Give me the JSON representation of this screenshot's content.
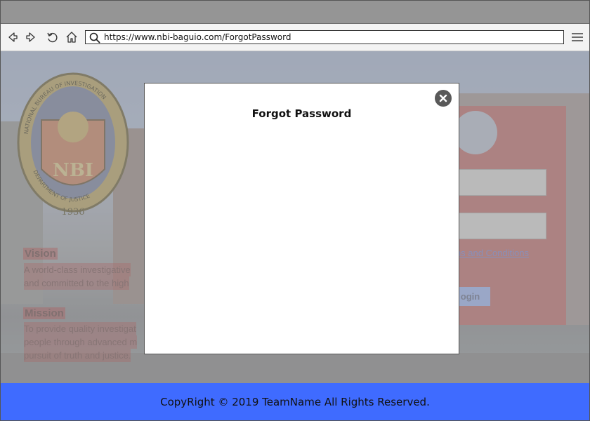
{
  "browser": {
    "url": "https://www.nbi-baguio.com/ForgotPassword",
    "icons": [
      "back-icon",
      "forward-icon",
      "reload-icon",
      "home-icon",
      "search-icon",
      "hamburger-menu-icon"
    ]
  },
  "background_page": {
    "seal": {
      "top_text": "NATIONAL BUREAU OF INVESTIGATION",
      "center_text": "NBI",
      "bottom_text": "DEPARTMENT OF JUSTICE",
      "year": "1936"
    },
    "vision": {
      "title": "Vision",
      "line1": "A world-class investigative",
      "line2": "and committed to the high"
    },
    "mission": {
      "title": "Mission",
      "line1": "To provide quality investigat",
      "line2": "people through advanced m",
      "line3": "pursuit of truth and justice."
    },
    "login": {
      "terms_text": "rms and Conditions",
      "login_button": "ogin"
    }
  },
  "modal": {
    "title": "Forgot Password",
    "close_icon": "close-icon"
  },
  "footer": {
    "text": "CopyRight © 2019 TeamName All Rights Reserved."
  },
  "colors": {
    "footer_bg": "#3f6bff",
    "titlebar": "#959595",
    "login_box": "#d25050",
    "close_button": "#595959"
  }
}
